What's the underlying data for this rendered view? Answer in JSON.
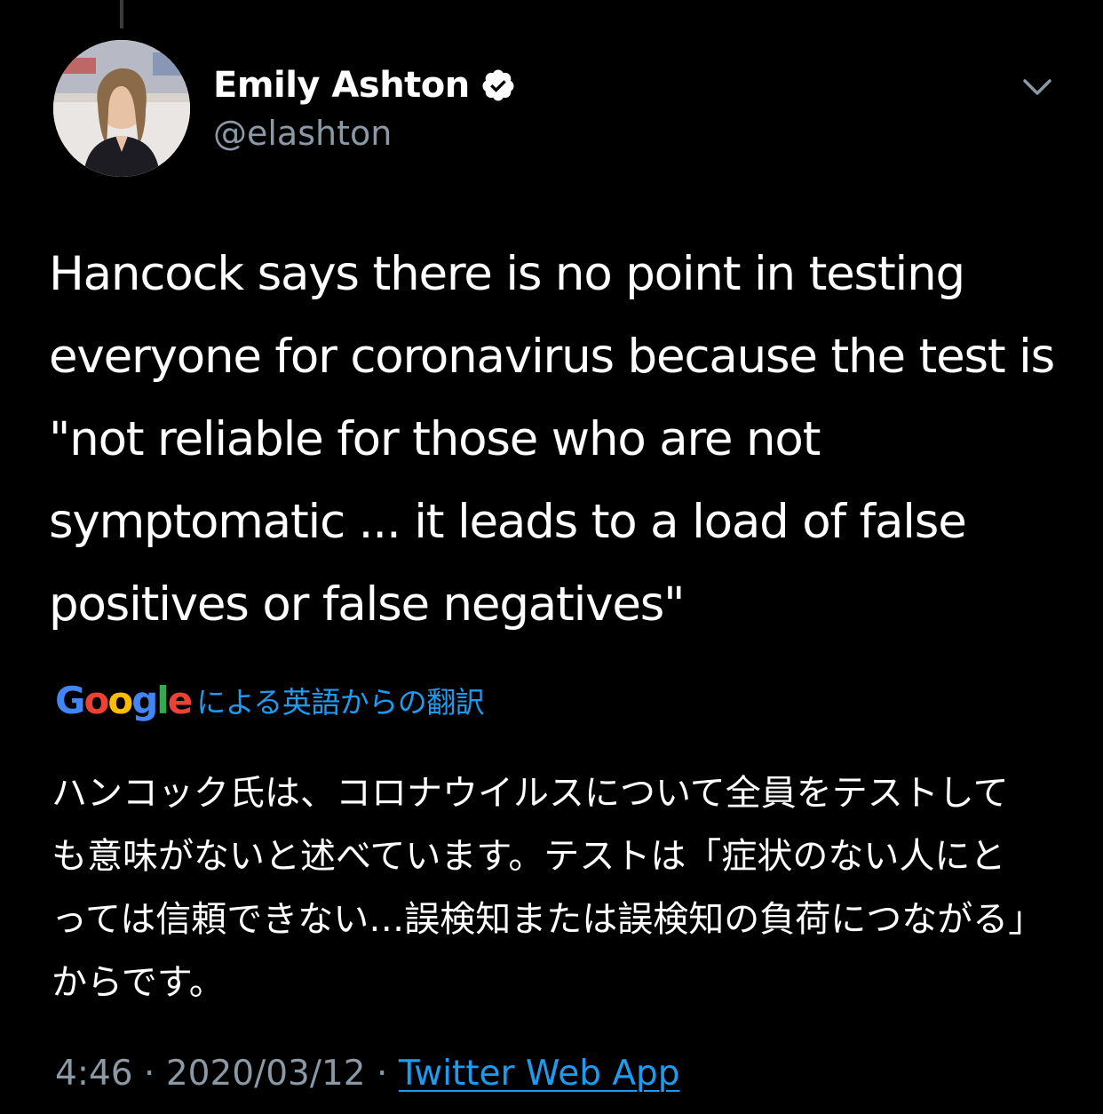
{
  "author": {
    "name": "Emily Ashton",
    "handle": "@elashton",
    "verified": true
  },
  "icons": {
    "verified": "verified-badge-icon",
    "menu": "chevron-down-icon"
  },
  "tweet": {
    "text": "Hancock says there is no point in testing everyone for coronavirus because the test is \"not reliable for those who are not symptomatic ... it leads to a load of false positives or false negatives\"",
    "translation_label": "による英語からの翻訳",
    "translation_provider": "Google",
    "translation_text": "ハンコック氏は、コロナウイルスについて全員をテストしても意味がないと述べています。テストは「症状のない人にとっては信頼できない…誤検知または誤検知の負荷につながる」からです。",
    "time": "4:46",
    "date": "2020/03/12",
    "separator": "·",
    "source": "Twitter Web App"
  },
  "colors": {
    "background": "#000000",
    "text": "#ffffff",
    "secondary_text": "#8b98a5",
    "link": "#1d9bf0",
    "google_blue": "#4285F4",
    "google_red": "#EA4335",
    "google_yellow": "#FBBC05",
    "google_green": "#34A853"
  }
}
